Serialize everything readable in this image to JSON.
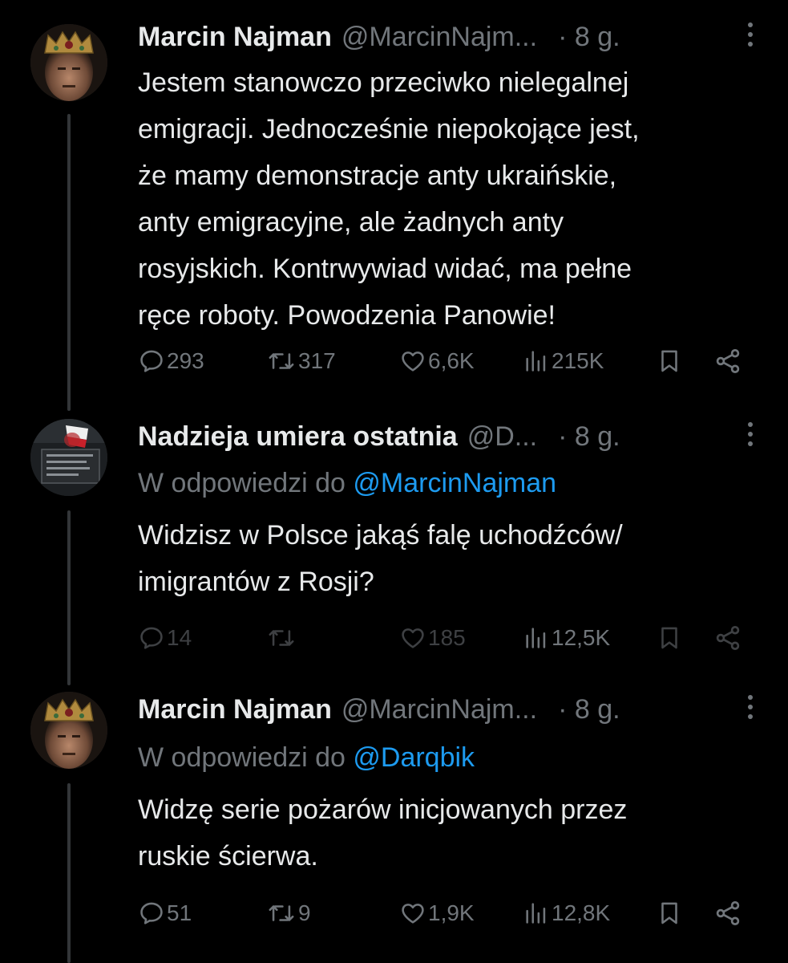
{
  "tweets": [
    {
      "name": "Marcin Najman",
      "handle": "@MarcinNajm...",
      "time": "· 8 g.",
      "reply_to_prefix": "",
      "reply_to_mention": "",
      "text_lines": [
        "Jestem stanowczo przeciwko nielegalnej",
        "emigracji. Jednocześnie niepokojące jest,",
        "że mamy demonstracje anty ukraińskie,",
        "anty emigracyjne, ale żadnych anty",
        "rosyjskich. Kontrwywiad widać, ma pełne",
        "ręce roboty. Powodzenia Panowie!"
      ],
      "replies": "293",
      "reposts": "317",
      "likes": "6,6K",
      "views": "215K"
    },
    {
      "name": "Nadzieja umiera ostatnia",
      "handle": "@D...",
      "time": "· 8 g.",
      "reply_to_prefix": "W odpowiedzi do ",
      "reply_to_mention": "@MarcinNajman",
      "text_lines": [
        "Widzisz w Polsce jakąś falę uchodźców/",
        "imigrantów z Rosji?"
      ],
      "replies": "14",
      "reposts": "",
      "likes": "185",
      "views": "12,5K"
    },
    {
      "name": "Marcin Najman",
      "handle": "@MarcinNajm...",
      "time": "· 8 g.",
      "reply_to_prefix": "W odpowiedzi do ",
      "reply_to_mention": "@Darqbik",
      "text_lines": [
        "Widzę serie pożarów inicjowanych przez",
        "ruskie ścierwa."
      ],
      "replies": "51",
      "reposts": "9",
      "likes": "1,9K",
      "views": "12,8K"
    }
  ],
  "icons": {
    "reply": "reply-icon",
    "repost": "repost-icon",
    "like": "heart-icon",
    "views": "views-icon",
    "bookmark": "bookmark-icon",
    "share": "share-icon",
    "more": "more-options-icon"
  },
  "colors": {
    "background": "#000000",
    "text": "#e7e9ea",
    "secondary": "#71767b",
    "link": "#1d9bf0"
  }
}
